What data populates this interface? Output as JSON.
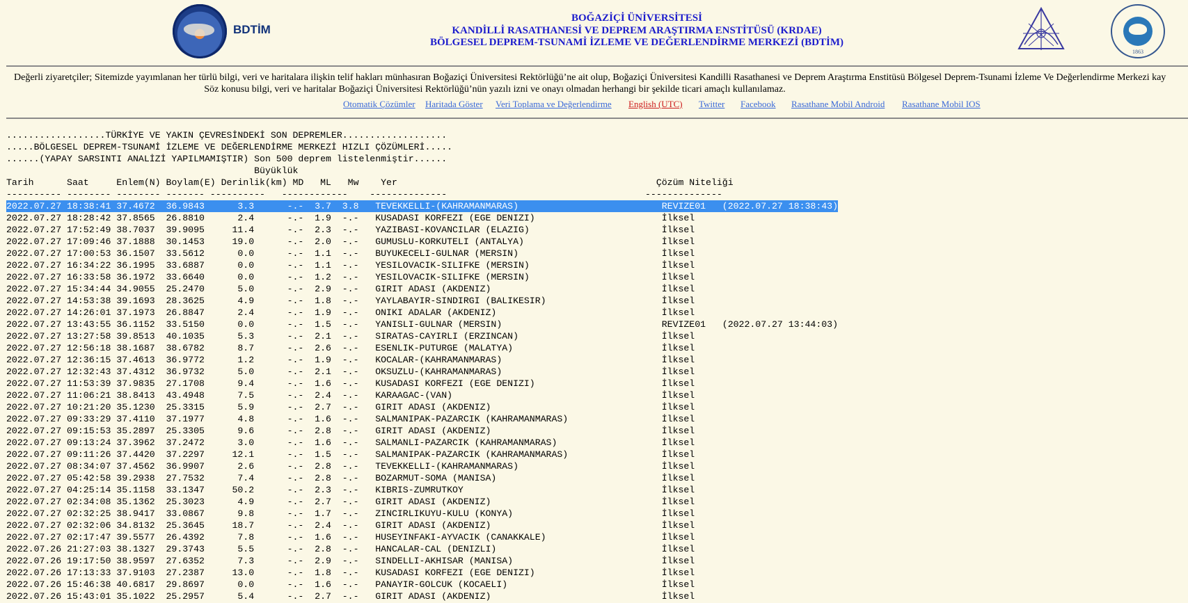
{
  "header": {
    "left_logo_text": "BDTİM",
    "title_lines": [
      "BOĞAZİÇİ ÜNİVERSİTESİ",
      "KANDİLLİ RASATHANESİ VE DEPREM ARAŞTIRMA ENSTİTÜSÜ (KRDAE)",
      "BÖLGESEL DEPREM-TSUNAMİ İZLEME VE DEĞERLENDİRME MERKEZİ (BDTİM)"
    ],
    "right_logo_year": "1863"
  },
  "notice": {
    "line1": "Değerli ziyaretçiler; Sitemizde yayımlanan her türlü bilgi, veri ve haritalara ilişkin telif hakları münhasıran Boğaziçi Üniversitesi Rektörlüğü’ne ait olup, Boğaziçi Üniversitesi Kandilli Rasathanesi ve Deprem Araştırma Enstitüsü Bölgesel Deprem-Tsunami İzleme Ve Değerlendirme Merkezi kay",
    "line2": "Söz konusu bilgi, veri ve haritalar Boğaziçi Üniversitesi Rektörlüğü’nün yazılı izni ve onayı olmadan herhangi bir şekilde ticari amaçlı kullanılamaz."
  },
  "links": [
    {
      "label": "Otomatik Çözümler"
    },
    {
      "label": "Haritada Göster"
    },
    {
      "label": "Veri Toplama ve Değerlendirme"
    },
    {
      "label": "English (UTC)"
    },
    {
      "label": "Twitter"
    },
    {
      "label": "Facebook"
    },
    {
      "label": "Rasathane Mobil Android"
    },
    {
      "label": "Rasathane Mobil IOS"
    }
  ],
  "listing": {
    "intro_lines": [
      "..................TÜRKİYE VE YAKIN ÇEVRESİNDEKİ SON DEPREMLER...................",
      ".....BÖLGESEL DEPREM-TSUNAMİ İZLEME VE DEĞERLENDİRME MERKEZİ HIZLI ÇÖZÜMLERİ.....",
      "......(YAPAY SARSINTI ANALİZİ YAPILMAMIŞTIR) Son 500 deprem listelenmiştir......"
    ],
    "magnitude_group_label": "Büyüklük",
    "columns": {
      "date": "Tarih",
      "time": "Saat",
      "lat": "Enlem(N)",
      "lon": "Boylam(E)",
      "depth": "Derinlik(km)",
      "md": "MD",
      "ml": "ML",
      "mw": "Mw",
      "place": "Yer",
      "quality": "Çözüm Niteliği"
    },
    "rows": [
      {
        "date": "2022.07.27",
        "time": "18:38:41",
        "lat": "37.4672",
        "lon": "36.9843",
        "depth": "3.3",
        "md": "-.-",
        "ml": "3.7",
        "mw": "3.8",
        "place": "TEVEKKELLI-(KAHRAMANMARAS)",
        "quality": "REVIZE01",
        "rev": "(2022.07.27 18:38:43)",
        "selected": true
      },
      {
        "date": "2022.07.27",
        "time": "18:28:42",
        "lat": "37.8565",
        "lon": "26.8810",
        "depth": "2.4",
        "md": "-.-",
        "ml": "1.9",
        "mw": "-.-",
        "place": "KUSADASI KORFEZI (EGE DENIZI)",
        "quality": "İlksel"
      },
      {
        "date": "2022.07.27",
        "time": "17:52:49",
        "lat": "38.7037",
        "lon": "39.9095",
        "depth": "11.4",
        "md": "-.-",
        "ml": "2.3",
        "mw": "-.-",
        "place": "YAZIBASI-KOVANCILAR (ELAZIG)",
        "quality": "İlksel"
      },
      {
        "date": "2022.07.27",
        "time": "17:09:46",
        "lat": "37.1888",
        "lon": "30.1453",
        "depth": "19.0",
        "md": "-.-",
        "ml": "2.0",
        "mw": "-.-",
        "place": "GUMUSLU-KORKUTELI (ANTALYA)",
        "quality": "İlksel"
      },
      {
        "date": "2022.07.27",
        "time": "17:00:53",
        "lat": "36.1507",
        "lon": "33.5612",
        "depth": "0.0",
        "md": "-.-",
        "ml": "1.1",
        "mw": "-.-",
        "place": "BUYUKECELI-GULNAR (MERSIN)",
        "quality": "İlksel"
      },
      {
        "date": "2022.07.27",
        "time": "16:34:22",
        "lat": "36.1995",
        "lon": "33.6887",
        "depth": "0.0",
        "md": "-.-",
        "ml": "1.1",
        "mw": "-.-",
        "place": "YESILOVACIK-SILIFKE (MERSIN)",
        "quality": "İlksel"
      },
      {
        "date": "2022.07.27",
        "time": "16:33:58",
        "lat": "36.1972",
        "lon": "33.6640",
        "depth": "0.0",
        "md": "-.-",
        "ml": "1.2",
        "mw": "-.-",
        "place": "YESILOVACIK-SILIFKE (MERSIN)",
        "quality": "İlksel"
      },
      {
        "date": "2022.07.27",
        "time": "15:34:44",
        "lat": "34.9055",
        "lon": "25.2470",
        "depth": "5.0",
        "md": "-.-",
        "ml": "2.9",
        "mw": "-.-",
        "place": "GIRIT ADASI (AKDENIZ)",
        "quality": "İlksel"
      },
      {
        "date": "2022.07.27",
        "time": "14:53:38",
        "lat": "39.1693",
        "lon": "28.3625",
        "depth": "4.9",
        "md": "-.-",
        "ml": "1.8",
        "mw": "-.-",
        "place": "YAYLABAYIR-SINDIRGI (BALIKESIR)",
        "quality": "İlksel"
      },
      {
        "date": "2022.07.27",
        "time": "14:26:01",
        "lat": "37.1973",
        "lon": "26.8847",
        "depth": "2.4",
        "md": "-.-",
        "ml": "1.9",
        "mw": "-.-",
        "place": "ONIKI ADALAR (AKDENIZ)",
        "quality": "İlksel"
      },
      {
        "date": "2022.07.27",
        "time": "13:43:55",
        "lat": "36.1152",
        "lon": "33.5150",
        "depth": "0.0",
        "md": "-.-",
        "ml": "1.5",
        "mw": "-.-",
        "place": "YANISLI-GULNAR (MERSIN)",
        "quality": "REVIZE01",
        "rev": "(2022.07.27 13:44:03)"
      },
      {
        "date": "2022.07.27",
        "time": "13:27:58",
        "lat": "39.8513",
        "lon": "40.1035",
        "depth": "5.3",
        "md": "-.-",
        "ml": "2.1",
        "mw": "-.-",
        "place": "SIRATAS-CAYIRLI (ERZINCAN)",
        "quality": "İlksel"
      },
      {
        "date": "2022.07.27",
        "time": "12:56:18",
        "lat": "38.1687",
        "lon": "38.6782",
        "depth": "8.7",
        "md": "-.-",
        "ml": "2.6",
        "mw": "-.-",
        "place": "ESENLIK-PUTURGE (MALATYA)",
        "quality": "İlksel"
      },
      {
        "date": "2022.07.27",
        "time": "12:36:15",
        "lat": "37.4613",
        "lon": "36.9772",
        "depth": "1.2",
        "md": "-.-",
        "ml": "1.9",
        "mw": "-.-",
        "place": "KOCALAR-(KAHRAMANMARAS)",
        "quality": "İlksel"
      },
      {
        "date": "2022.07.27",
        "time": "12:32:43",
        "lat": "37.4312",
        "lon": "36.9732",
        "depth": "5.0",
        "md": "-.-",
        "ml": "2.1",
        "mw": "-.-",
        "place": "OKSUZLU-(KAHRAMANMARAS)",
        "quality": "İlksel"
      },
      {
        "date": "2022.07.27",
        "time": "11:53:39",
        "lat": "37.9835",
        "lon": "27.1708",
        "depth": "9.4",
        "md": "-.-",
        "ml": "1.6",
        "mw": "-.-",
        "place": "KUSADASI KORFEZI (EGE DENIZI)",
        "quality": "İlksel"
      },
      {
        "date": "2022.07.27",
        "time": "11:06:21",
        "lat": "38.8413",
        "lon": "43.4948",
        "depth": "7.5",
        "md": "-.-",
        "ml": "2.4",
        "mw": "-.-",
        "place": "KARAAGAC-(VAN)",
        "quality": "İlksel"
      },
      {
        "date": "2022.07.27",
        "time": "10:21:20",
        "lat": "35.1230",
        "lon": "25.3315",
        "depth": "5.9",
        "md": "-.-",
        "ml": "2.7",
        "mw": "-.-",
        "place": "GIRIT ADASI (AKDENIZ)",
        "quality": "İlksel"
      },
      {
        "date": "2022.07.27",
        "time": "09:33:29",
        "lat": "37.4110",
        "lon": "37.1977",
        "depth": "4.8",
        "md": "-.-",
        "ml": "1.6",
        "mw": "-.-",
        "place": "SALMANIPAK-PAZARCIK (KAHRAMANMARAS)",
        "quality": "İlksel"
      },
      {
        "date": "2022.07.27",
        "time": "09:15:53",
        "lat": "35.2897",
        "lon": "25.3305",
        "depth": "9.6",
        "md": "-.-",
        "ml": "2.8",
        "mw": "-.-",
        "place": "GIRIT ADASI (AKDENIZ)",
        "quality": "İlksel"
      },
      {
        "date": "2022.07.27",
        "time": "09:13:24",
        "lat": "37.3962",
        "lon": "37.2472",
        "depth": "3.0",
        "md": "-.-",
        "ml": "1.6",
        "mw": "-.-",
        "place": "SALMANLI-PAZARCIK (KAHRAMANMARAS)",
        "quality": "İlksel"
      },
      {
        "date": "2022.07.27",
        "time": "09:11:26",
        "lat": "37.4420",
        "lon": "37.2297",
        "depth": "12.1",
        "md": "-.-",
        "ml": "1.5",
        "mw": "-.-",
        "place": "SALMANIPAK-PAZARCIK (KAHRAMANMARAS)",
        "quality": "İlksel"
      },
      {
        "date": "2022.07.27",
        "time": "08:34:07",
        "lat": "37.4562",
        "lon": "36.9907",
        "depth": "2.6",
        "md": "-.-",
        "ml": "2.8",
        "mw": "-.-",
        "place": "TEVEKKELLI-(KAHRAMANMARAS)",
        "quality": "İlksel"
      },
      {
        "date": "2022.07.27",
        "time": "05:42:58",
        "lat": "39.2938",
        "lon": "27.7532",
        "depth": "7.4",
        "md": "-.-",
        "ml": "2.8",
        "mw": "-.-",
        "place": "BOZARMUT-SOMA (MANISA)",
        "quality": "İlksel"
      },
      {
        "date": "2022.07.27",
        "time": "04:25:14",
        "lat": "35.1158",
        "lon": "33.1347",
        "depth": "50.2",
        "md": "-.-",
        "ml": "2.3",
        "mw": "-.-",
        "place": "KIBRIS-ZUMRUTKOY",
        "quality": "İlksel"
      },
      {
        "date": "2022.07.27",
        "time": "02:34:08",
        "lat": "35.1362",
        "lon": "25.3023",
        "depth": "4.9",
        "md": "-.-",
        "ml": "2.7",
        "mw": "-.-",
        "place": "GIRIT ADASI (AKDENIZ)",
        "quality": "İlksel"
      },
      {
        "date": "2022.07.27",
        "time": "02:32:25",
        "lat": "38.9417",
        "lon": "33.0867",
        "depth": "9.8",
        "md": "-.-",
        "ml": "1.7",
        "mw": "-.-",
        "place": "ZINCIRLIKUYU-KULU (KONYA)",
        "quality": "İlksel"
      },
      {
        "date": "2022.07.27",
        "time": "02:32:06",
        "lat": "34.8132",
        "lon": "25.3645",
        "depth": "18.7",
        "md": "-.-",
        "ml": "2.4",
        "mw": "-.-",
        "place": "GIRIT ADASI (AKDENIZ)",
        "quality": "İlksel"
      },
      {
        "date": "2022.07.27",
        "time": "02:17:47",
        "lat": "39.5577",
        "lon": "26.4392",
        "depth": "7.8",
        "md": "-.-",
        "ml": "1.6",
        "mw": "-.-",
        "place": "HUSEYINFAKI-AYVACIK (CANAKKALE)",
        "quality": "İlksel"
      },
      {
        "date": "2022.07.26",
        "time": "21:27:03",
        "lat": "38.1327",
        "lon": "29.3743",
        "depth": "5.5",
        "md": "-.-",
        "ml": "2.8",
        "mw": "-.-",
        "place": "HANCALAR-CAL (DENIZLI)",
        "quality": "İlksel"
      },
      {
        "date": "2022.07.26",
        "time": "19:17:50",
        "lat": "38.9597",
        "lon": "27.6352",
        "depth": "7.3",
        "md": "-.-",
        "ml": "2.9",
        "mw": "-.-",
        "place": "SINDELLI-AKHISAR (MANISA)",
        "quality": "İlksel"
      },
      {
        "date": "2022.07.26",
        "time": "17:13:33",
        "lat": "37.9103",
        "lon": "27.2387",
        "depth": "13.0",
        "md": "-.-",
        "ml": "1.8",
        "mw": "-.-",
        "place": "KUSADASI KORFEZI (EGE DENIZI)",
        "quality": "İlksel"
      },
      {
        "date": "2022.07.26",
        "time": "15:46:38",
        "lat": "40.6817",
        "lon": "29.8697",
        "depth": "0.0",
        "md": "-.-",
        "ml": "1.6",
        "mw": "-.-",
        "place": "PANAYIR-GOLCUK (KOCAELI)",
        "quality": "İlksel"
      },
      {
        "date": "2022.07.26",
        "time": "15:43:01",
        "lat": "35.1022",
        "lon": "25.2957",
        "depth": "5.4",
        "md": "-.-",
        "ml": "2.7",
        "mw": "-.-",
        "place": "GIRIT ADASI (AKDENIZ)",
        "quality": "İlksel"
      }
    ]
  }
}
